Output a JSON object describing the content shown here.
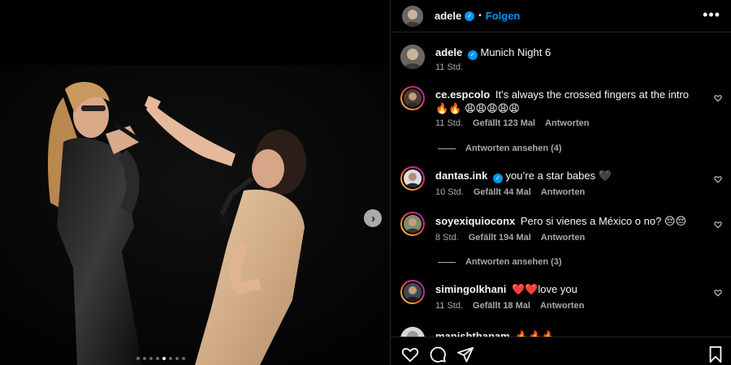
{
  "post": {
    "username": "adele",
    "follow_label": "Folgen",
    "separator": "•",
    "caption": "Munich Night 6",
    "caption_time": "11 Std."
  },
  "media": {
    "next_icon": "chevron-right-icon",
    "dot_count": 8,
    "active_dot": 4
  },
  "comments": [
    {
      "username": "ce.espcolo",
      "text": "It’s always the crossed fingers at the intro 🔥🔥 😩😩😩😩😩",
      "time": "11 Std.",
      "likes": "Gefällt 123 Mal",
      "reply": "Antworten",
      "view_replies": "Antworten ansehen (4)"
    },
    {
      "username": "dantas.ink",
      "text": "you’re a star babes 🖤",
      "time": "10 Std.",
      "likes": "Gefällt 44 Mal",
      "reply": "Antworten"
    },
    {
      "username": "soyexiquioconx",
      "text": "Pero si vienes a México o no? 😔😔",
      "time": "8 Std.",
      "likes": "Gefällt 194 Mal",
      "reply": "Antworten",
      "view_replies": "Antworten ansehen (3)"
    },
    {
      "username": "simingolkhani",
      "text": "❤️❤️love you",
      "time": "11 Std.",
      "likes": "Gefällt 18 Mal",
      "reply": "Antworten"
    },
    {
      "username": "manishthapam",
      "text": "🔥🔥🔥"
    }
  ],
  "icons": {
    "more": "more-icon",
    "heart": "heart-icon",
    "comment": "comment-icon",
    "share": "share-icon",
    "bookmark": "bookmark-icon"
  },
  "colors": {
    "background": "#000000",
    "accent": "#0095f6",
    "muted": "#a8a8a8",
    "divider": "#262626"
  }
}
